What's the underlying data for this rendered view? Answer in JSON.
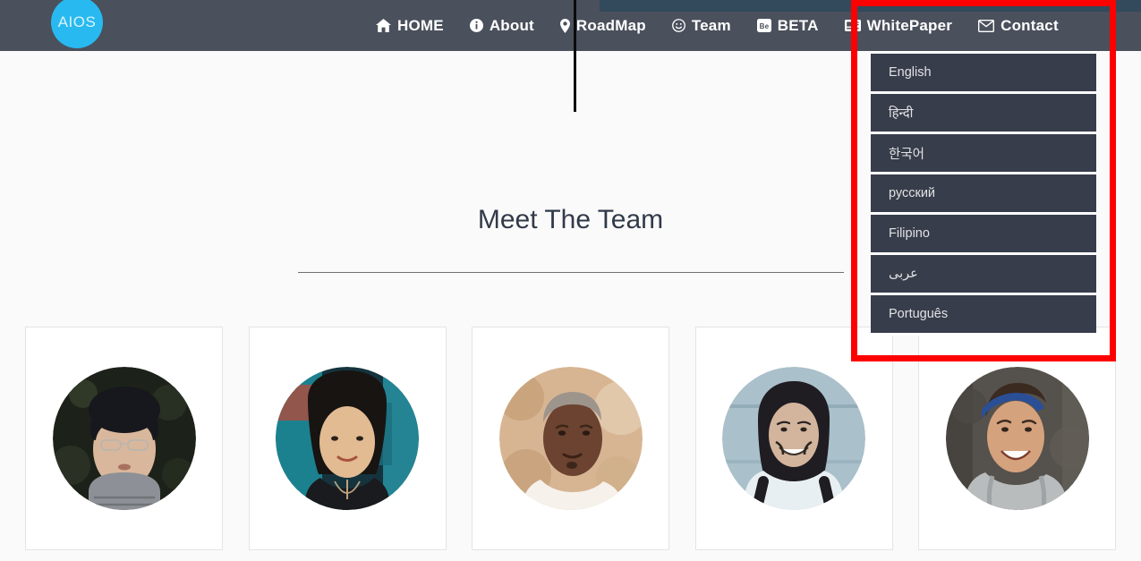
{
  "navbar": {
    "logo_text": "AIOS",
    "brand_color": "#28b9f0",
    "bar_color": "#4a505c",
    "top_band_color": "#33495c",
    "items": [
      {
        "label": "HOME",
        "icon": "home-icon"
      },
      {
        "label": "About",
        "icon": "info-circle-icon"
      },
      {
        "label": "RoadMap",
        "icon": "map-marker-icon"
      },
      {
        "label": "Team",
        "icon": "smiley-icon"
      },
      {
        "label": "BETA",
        "icon": "behance-square-icon"
      },
      {
        "label": "WhitePaper",
        "icon": "newspaper-icon"
      },
      {
        "label": "Contact",
        "icon": "envelope-icon"
      }
    ]
  },
  "highlight": {
    "name": "red-annotation-box",
    "color": "#ff0000"
  },
  "language_dropdown": {
    "background": "#383d4b",
    "text_color": "#e2e2e4",
    "items": [
      {
        "label": "English"
      },
      {
        "label": "हिन्दी"
      },
      {
        "label": "한국어"
      },
      {
        "label": "русский"
      },
      {
        "label": "Filipino"
      },
      {
        "label": "عربى"
      },
      {
        "label": "Português"
      }
    ]
  },
  "main": {
    "section_title": "Meet The Team",
    "team": [
      {
        "name": "team-member-1",
        "alt": "man in dark beanie and glasses with scarf",
        "tone": "#2b3038",
        "skin": "#d9b79c",
        "hair": "#16181d",
        "bg": "#1c2219"
      },
      {
        "name": "team-member-2",
        "alt": "woman with long dark hair and necklace",
        "tone": "#1d3b45",
        "skin": "#e2bb93",
        "hair": "#171412",
        "bg": "#15333c"
      },
      {
        "name": "team-member-3",
        "alt": "smiling man outdoors warm tones",
        "tone": "#d8b48e",
        "skin": "#6b4330",
        "hair": "#4a3226",
        "bg": "#d7b593"
      },
      {
        "name": "team-member-4",
        "alt": "smiling man with long curly hair in white shirt",
        "tone": "#a8bfc9",
        "skin": "#d3b49c",
        "hair": "#1f1d22",
        "bg": "#aac0ca"
      },
      {
        "name": "team-member-5",
        "alt": "smiling man with blue headband and grey hoodie",
        "tone": "#55514c",
        "skin": "#d5a27e",
        "hair": "#3a2a20",
        "bg": "#55514c"
      }
    ]
  }
}
